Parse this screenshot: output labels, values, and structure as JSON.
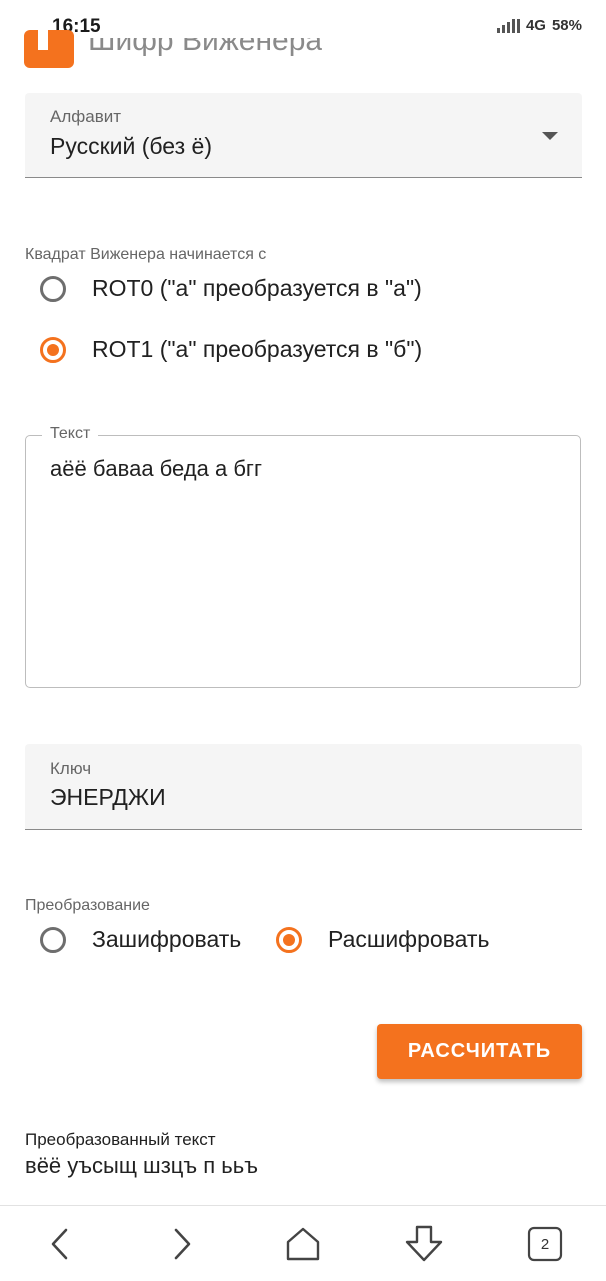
{
  "status_bar": {
    "time": "16:15",
    "network": "4G",
    "battery": "58%"
  },
  "header": {
    "title": "Шифр Виженера"
  },
  "alphabet": {
    "label": "Алфавит",
    "value": "Русский (без ё)"
  },
  "square": {
    "label": "Квадрат Виженера начинается с",
    "options": [
      {
        "label": "ROT0 (\"а\" преобразуется в \"а\")",
        "checked": false
      },
      {
        "label": "ROT1 (\"а\" преобразуется в \"б\")",
        "checked": true
      }
    ]
  },
  "text_field": {
    "label": "Текст",
    "value": "аёё бaваа беда а бгг"
  },
  "key_field": {
    "label": "Ключ",
    "value": "ЭНЕРДЖИ"
  },
  "transform": {
    "label": "Преобразование",
    "options": [
      {
        "label": "Зашифровать",
        "checked": false
      },
      {
        "label": "Расшифровать",
        "checked": true
      }
    ]
  },
  "calculate_button": {
    "label": "РАССЧИТАТЬ"
  },
  "result": {
    "label": "Преобразованный текст",
    "value": "вёё уъсыщ шзцъ п ььъ"
  },
  "bottom_nav": {
    "tab_count": "2"
  },
  "colors": {
    "accent": "#f4721e",
    "field_bg": "#f5f5f5"
  },
  "icons": [
    "back-icon",
    "forward-icon",
    "home-icon",
    "download-icon",
    "tabs-icon",
    "select-arrow-icon"
  ]
}
